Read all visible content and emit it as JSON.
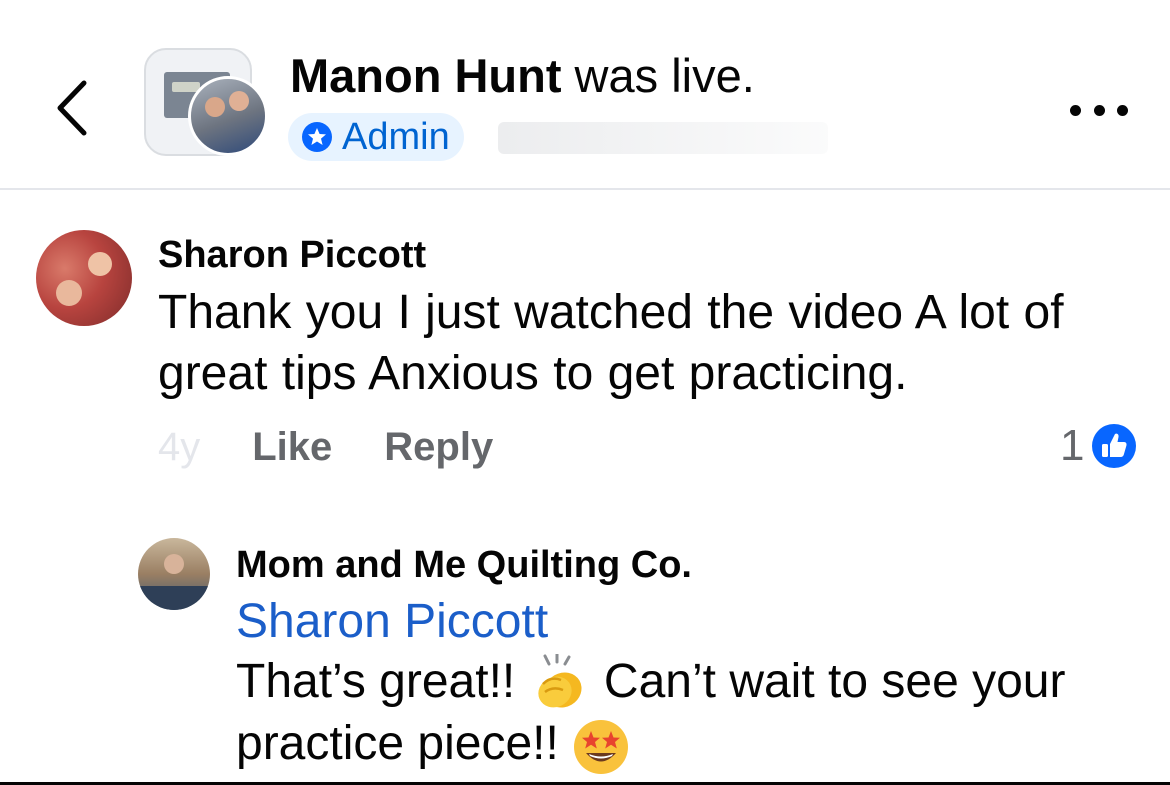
{
  "header": {
    "author_name": "Manon Hunt",
    "title_suffix": " was live.",
    "badge_label": "Admin"
  },
  "comment": {
    "author": "Sharon Piccott",
    "text": "Thank you   I just watched the video   A lot of great tips  Anxious to get practicing.",
    "age": "4y",
    "like_label": "Like",
    "reply_label": "Reply",
    "reaction_count": "1"
  },
  "reply": {
    "author": "Mom and Me Quilting Co.",
    "mention": "Sharon Piccott",
    "text_part1": "That’s great!! ",
    "text_part2": " Can’t wait to see your practice piece!! "
  },
  "icons": {
    "back": "chevron-left-icon",
    "more": "more-horizontal-icon",
    "admin": "admin-star-icon",
    "like_reaction": "like-thumb-icon",
    "clap": "clapping-hands-icon",
    "star_struck": "star-struck-icon"
  },
  "colors": {
    "accent": "#0866ff",
    "badge_bg": "#e7f3ff",
    "mention": "#1b5ec9",
    "secondary_text": "#65676b"
  }
}
